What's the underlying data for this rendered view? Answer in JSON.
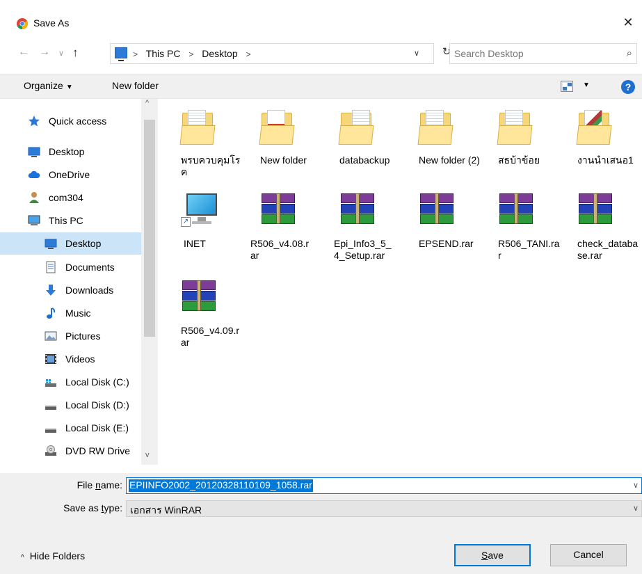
{
  "window": {
    "title": "Save As",
    "close_glyph": "✕"
  },
  "nav": {
    "back_glyph": "←",
    "forward_glyph": "→",
    "recent_glyph": "∨",
    "up_glyph": "↑",
    "breadcrumbs": [
      "This PC",
      "Desktop"
    ],
    "breadcrumb_sep": ">",
    "dropdown_glyph": "∨",
    "refresh_glyph": "↻",
    "search_placeholder": "Search Desktop",
    "search_glyph": "⌕"
  },
  "toolbar": {
    "organize_label": "Organize",
    "organize_caret": "▼",
    "new_folder_label": "New folder",
    "view_caret": "▼",
    "help_glyph": "?"
  },
  "sidebar": {
    "scroll_up": "^",
    "scroll_down": "v",
    "items": [
      {
        "label": "Quick access",
        "icon": "star-icon"
      },
      {
        "label": "Desktop",
        "icon": "desktop-icon"
      },
      {
        "label": "OneDrive",
        "icon": "cloud-icon"
      },
      {
        "label": "com304",
        "icon": "user-icon"
      },
      {
        "label": "This PC",
        "icon": "computer-icon"
      },
      {
        "label": "Desktop",
        "icon": "desktop-icon",
        "selected": true
      },
      {
        "label": "Documents",
        "icon": "document-icon"
      },
      {
        "label": "Downloads",
        "icon": "download-icon"
      },
      {
        "label": "Music",
        "icon": "music-icon"
      },
      {
        "label": "Pictures",
        "icon": "picture-icon"
      },
      {
        "label": "Videos",
        "icon": "video-icon"
      },
      {
        "label": "Local Disk (C:)",
        "icon": "disk-icon"
      },
      {
        "label": "Local Disk (D:)",
        "icon": "disk-icon"
      },
      {
        "label": "Local Disk (E:)",
        "icon": "disk-icon"
      },
      {
        "label": "DVD RW Drive",
        "icon": "dvd-icon"
      }
    ]
  },
  "files": [
    {
      "name": "พรบควบคุมโรค",
      "type": "folder"
    },
    {
      "name": "New folder",
      "type": "folder"
    },
    {
      "name": "databackup",
      "type": "folder"
    },
    {
      "name": "New folder (2)",
      "type": "folder"
    },
    {
      "name": "สธบ้าข้อย",
      "type": "folder"
    },
    {
      "name": "งานนำเสนอ1",
      "type": "folder"
    },
    {
      "name": "INET",
      "type": "shortcut",
      "shortcut_glyph": "↗"
    },
    {
      "name": "R506_v4.08.rar",
      "type": "rar"
    },
    {
      "name": "Epi_Info3_5_4_Setup.rar",
      "type": "rar"
    },
    {
      "name": "EPSEND.rar",
      "type": "rar"
    },
    {
      "name": "R506_TANI.rar",
      "type": "rar"
    },
    {
      "name": "check_database.rar",
      "type": "rar"
    },
    {
      "name": "R506_v4.09.rar",
      "type": "rar"
    }
  ],
  "form": {
    "file_name_label_pre": "File ",
    "file_name_label_u": "n",
    "file_name_label_post": "ame:",
    "file_name_value": "EPIINFO2002_20120328110109_1058.rar",
    "save_type_label_pre": "Save as ",
    "save_type_label_u": "t",
    "save_type_label_post": "ype:",
    "save_type_value": "เอกสาร WinRAR",
    "dropdown_glyph": "∨",
    "hide_folders_glyph": "^",
    "hide_folders_label": "Hide Folders",
    "save_label_u": "S",
    "save_label_rest": "ave",
    "cancel_label": "Cancel"
  },
  "colors": {
    "accent": "#0078d7",
    "selection": "#cce4f7",
    "help": "#1f6fd1"
  }
}
